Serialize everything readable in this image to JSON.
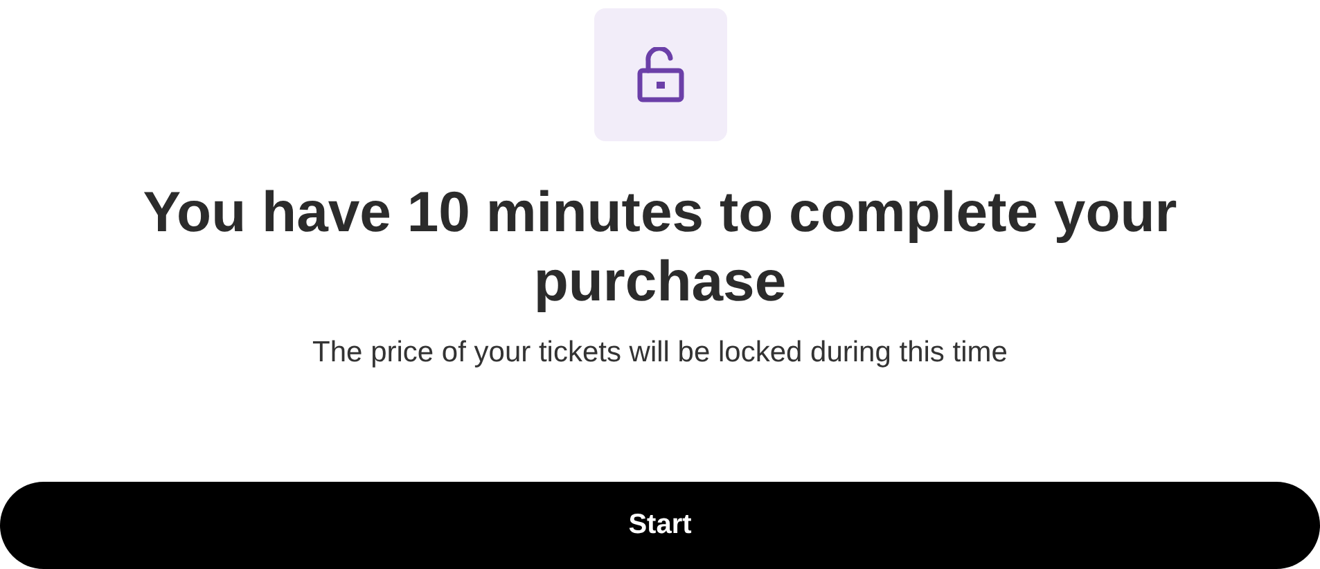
{
  "title": "You have 10 minutes to complete your purchase",
  "subtitle": "The price of your tickets will be locked during this time",
  "button": {
    "label": "Start"
  }
}
